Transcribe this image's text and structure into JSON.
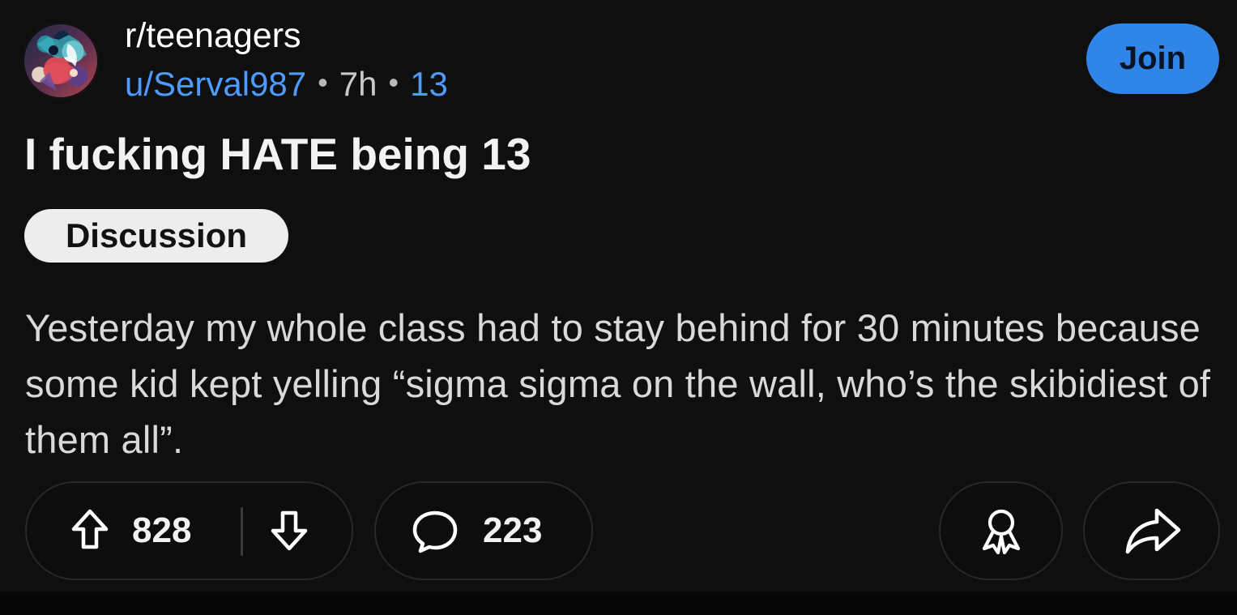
{
  "post": {
    "subreddit": "r/teenagers",
    "author": "u/Serval987",
    "separator": "•",
    "age": "7h",
    "author_flair": "13",
    "join_label": "Join",
    "title": "I fucking HATE being 13",
    "flair": "Discussion",
    "body": "Yesterday my whole class had to stay behind for 30 minutes because some kid kept yelling “sigma sigma on the wall, who’s the skibidiest of them all”."
  },
  "actions": {
    "upvotes": "828",
    "comments": "223"
  },
  "icons": {
    "upvote": "upvote-arrow-icon",
    "downvote": "downvote-arrow-icon",
    "comment": "comment-bubble-icon",
    "award": "award-icon",
    "share": "share-arrow-icon"
  },
  "colors": {
    "background": "#0f0f10",
    "link_blue": "#4e9bff",
    "join_button": "#2f86e8",
    "flair_background": "#ededed"
  }
}
